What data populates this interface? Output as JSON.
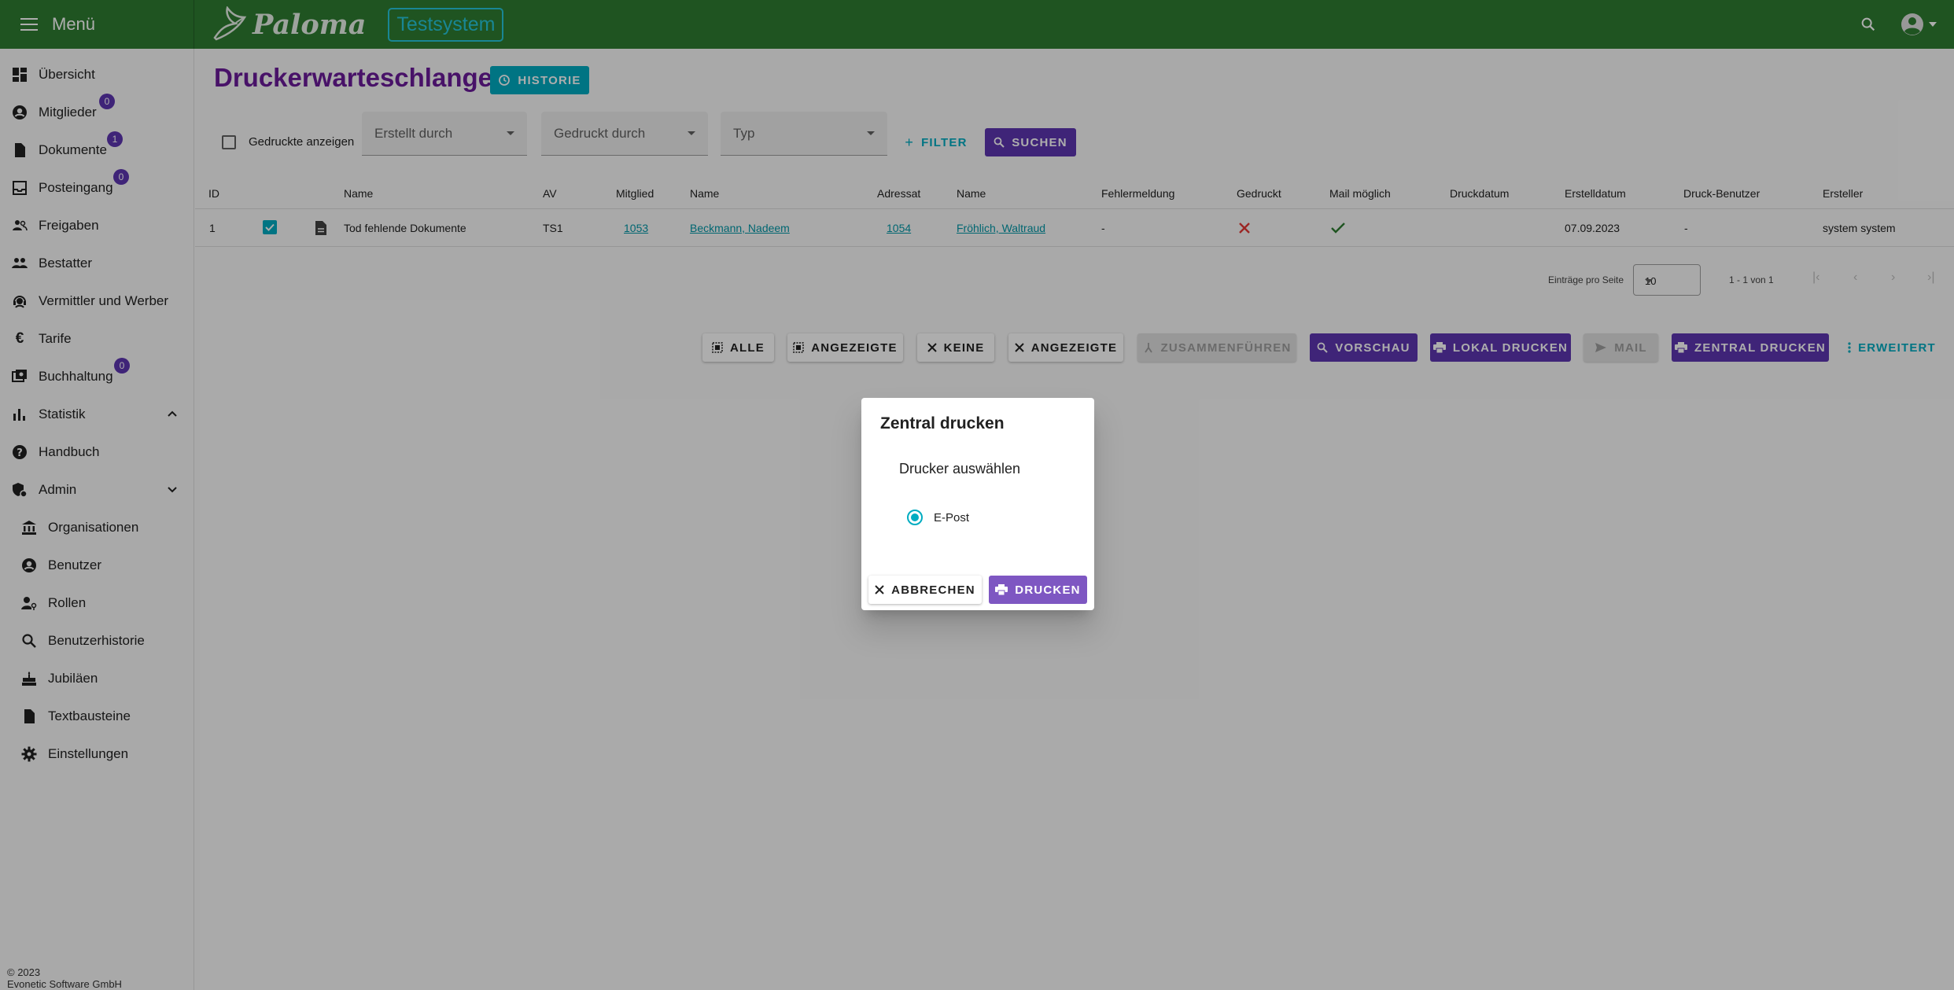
{
  "topbar": {
    "menu_label": "Menü",
    "logo_text": "Paloma",
    "env_badge": "Testsystem"
  },
  "sidebar": {
    "items": [
      {
        "label": "Übersicht",
        "icon": "dashboard-icon"
      },
      {
        "label": "Mitglieder",
        "icon": "account-circle-icon",
        "badge": "0"
      },
      {
        "label": "Dokumente",
        "icon": "document-icon",
        "badge": "1"
      },
      {
        "label": "Posteingang",
        "icon": "inbox-icon",
        "badge": "0"
      },
      {
        "label": "Freigaben",
        "icon": "share-people-icon"
      },
      {
        "label": "Bestatter",
        "icon": "people-icon"
      },
      {
        "label": "Vermittler und Werber",
        "icon": "support-agent-icon"
      },
      {
        "label": "Tarife",
        "icon": "euro-icon"
      },
      {
        "label": "Buchhaltung",
        "icon": "accounting-icon",
        "badge": "0"
      },
      {
        "label": "Statistik",
        "icon": "bar-chart-icon"
      },
      {
        "label": "Handbuch",
        "icon": "help-icon"
      },
      {
        "label": "Admin",
        "icon": "admin-shield-icon"
      },
      {
        "label": "Organisationen",
        "icon": "bank-icon"
      },
      {
        "label": "Benutzer",
        "icon": "account-circle-icon"
      },
      {
        "label": "Rollen",
        "icon": "user-key-icon"
      },
      {
        "label": "Benutzerhistorie",
        "icon": "search-icon"
      },
      {
        "label": "Jubiläen",
        "icon": "cake-icon"
      },
      {
        "label": "Textbausteine",
        "icon": "document-icon"
      },
      {
        "label": "Einstellungen",
        "icon": "gear-icon"
      }
    ],
    "footer_line1": "© 2023",
    "footer_line2": "Evonetic Software GmbH"
  },
  "page": {
    "title": "Druckerwarteschlange",
    "history_button": "Historie",
    "show_printed_label": "Gedruckte anzeigen",
    "filters": {
      "created_by": "Erstellt durch",
      "printed_by": "Gedruckt durch",
      "type": "Typ"
    },
    "filter_button": "Filter",
    "search_button": "Suchen"
  },
  "table": {
    "headers": [
      "ID",
      "Name",
      "AV",
      "Mitglied",
      "Name",
      "Adressat",
      "Name",
      "Fehlermeldung",
      "Gedruckt",
      "Mail möglich",
      "Druckdatum",
      "Erstelldatum",
      "Druck-Benutzer",
      "Ersteller"
    ],
    "rows": [
      {
        "id": "1",
        "name": "Tod fehlende Dokumente",
        "av": "TS1",
        "member": "1053",
        "member_name": "Beckmann, Nadeem",
        "addressee": "1054",
        "addressee_name": "Fröhlich, Waltraud",
        "error": "-",
        "print_date": "",
        "created_date": "07.09.2023",
        "print_user": "-",
        "creator": "system system"
      }
    ]
  },
  "paginator": {
    "per_page_label": "Einträge pro Seite",
    "per_page": "10",
    "range": "1 - 1 von 1"
  },
  "actions": {
    "all": "Alle",
    "shown_select": "Angezeigte",
    "none": "Keine",
    "shown_deselect": "Angezeigte",
    "merge": "Zusammenführen",
    "preview": "Vorschau",
    "local_print": "Lokal drucken",
    "mail": "Mail",
    "central_print": "Zentral drucken",
    "advanced": "Erweitert"
  },
  "dialog": {
    "title": "Zentral drucken",
    "subtitle": "Drucker auswählen",
    "option": "E-Post",
    "cancel": "Abbrechen",
    "confirm": "Drucken"
  },
  "colors": {
    "topbar": "#2e7d32",
    "accent_purple": "#5e35b1",
    "accent_cyan": "#00acc1",
    "title_purple": "#6a1b9a"
  }
}
